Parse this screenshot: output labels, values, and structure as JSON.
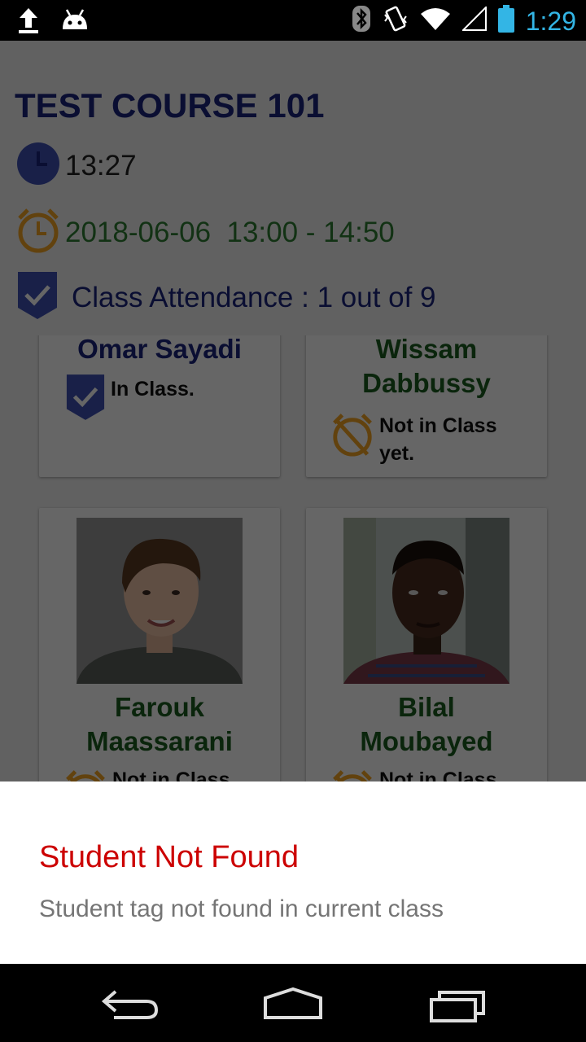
{
  "status_bar": {
    "time": "1:29",
    "icons": [
      "upload-icon",
      "android-icon",
      "bluetooth-icon",
      "vibrate-icon",
      "wifi-icon",
      "signal-icon",
      "battery-icon"
    ]
  },
  "course": {
    "title": "TEST COURSE 101",
    "current_time": "13:27",
    "schedule": "2018-06-06  13:00 - 14:50",
    "attendance": "Class Attendance : 1 out of 9"
  },
  "students": [
    {
      "name": "Omar Sayadi",
      "status": "In Class.",
      "status_icon": "check-shield-icon"
    },
    {
      "name": "Wissam\nDabbussy",
      "status": "Not in Class yet.",
      "status_icon": "alarm-off-icon"
    },
    {
      "name": "Farouk\nMaassarani",
      "status": "Not in Class",
      "status_icon": "alarm-off-icon"
    },
    {
      "name": "Bilal\nMoubayed",
      "status": "Not in Class",
      "status_icon": "alarm-off-icon"
    }
  ],
  "dialog": {
    "title": "Student Not Found",
    "message": "Student tag not found in current class"
  },
  "colors": {
    "title_blue": "#1a237e",
    "green": "#2e7d32",
    "dialog_title_red": "#cc0000",
    "clock_blue": "#33b5e5",
    "icon_blue": "#3f51b5",
    "icon_orange": "#f5a623"
  }
}
